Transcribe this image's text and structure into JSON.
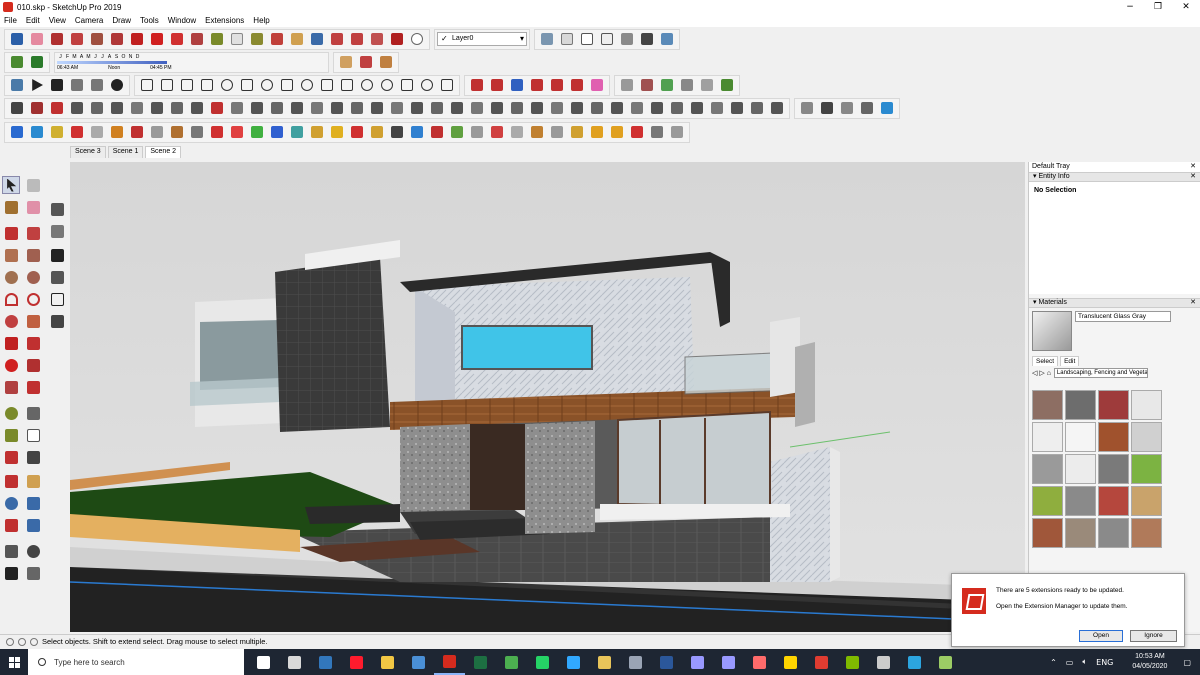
{
  "window": {
    "title": "010.skp - SketchUp Pro 2019",
    "controls": [
      "−",
      "❐",
      "✕"
    ]
  },
  "menu": [
    "File",
    "Edit",
    "View",
    "Camera",
    "Draw",
    "Tools",
    "Window",
    "Extensions",
    "Help"
  ],
  "toolbar": {
    "layer": "Layer0",
    "shadow_months": [
      "J",
      "F",
      "M",
      "A",
      "M",
      "J",
      "J",
      "A",
      "S",
      "O",
      "N",
      "D"
    ],
    "shadow_times": [
      "06:43 AM",
      "Noon",
      "04:45 PM"
    ]
  },
  "scenes": [
    "Scene 3",
    "Scene 1",
    "Scene 2"
  ],
  "active_scene": "Scene 2",
  "tray": {
    "title": "Default Tray",
    "entity_info": {
      "header": "Entity Info",
      "status": "No Selection"
    },
    "materials": {
      "header": "Materials",
      "name": "Translucent Glass Gray",
      "tabs": [
        "Select",
        "Edit"
      ],
      "collection": "Landscaping, Fencing and Vegetation",
      "swatch_colors": [
        "#8d6e63",
        "#6d6d6d",
        "#9e3b3b",
        "#e8e8e8",
        "#eeeeee",
        "#f5f5f5",
        "#a0522d",
        "#d0d0d0",
        "#9a9a9a",
        "#ececec",
        "#7a7a7a",
        "#7cb342",
        "#8fae3e",
        "#8a8a8a",
        "#b5473d",
        "#c9a36b",
        "#a0573a",
        "#9a8a7a",
        "#8a8a8a",
        "#b07a5a"
      ]
    }
  },
  "status_bar": {
    "text": "Select objects. Shift to extend select. Drag mouse to select multiple."
  },
  "notification": {
    "line1": "There are 5 extensions ready to be updated.",
    "line2": "Open the Extension Manager to update them.",
    "open_label": "Open",
    "ignore_label": "Ignore"
  },
  "taskbar": {
    "search_placeholder": "Type here to search",
    "lang": "ENG",
    "time": "10:53 AM",
    "date": "04/05/2020",
    "apps": [
      "task-view",
      "calculator",
      "edge",
      "opera",
      "file-explorer",
      "store",
      "sketchup",
      "excel",
      "chrome",
      "whatsapp",
      "photoshop",
      "app-12",
      "app-13",
      "word",
      "after-effects",
      "premiere",
      "app-17",
      "sticky-notes",
      "acrobat",
      "app-20",
      "app-21",
      "telegram",
      "app-23"
    ],
    "app_colors": [
      "#ffffff",
      "#d9d9d9",
      "#3277bc",
      "#ff1b2d",
      "#f2c744",
      "#4a8fd6",
      "#d52b1e",
      "#1d6f42",
      "#4caf50",
      "#25d366",
      "#31a8ff",
      "#e8c45a",
      "#9aa4b5",
      "#2b579a",
      "#9999ff",
      "#9999ff",
      "#ff6b6b",
      "#ffd400",
      "#e03c31",
      "#7fba00",
      "#cccccc",
      "#2ca5e0",
      "#9ccc65"
    ]
  }
}
